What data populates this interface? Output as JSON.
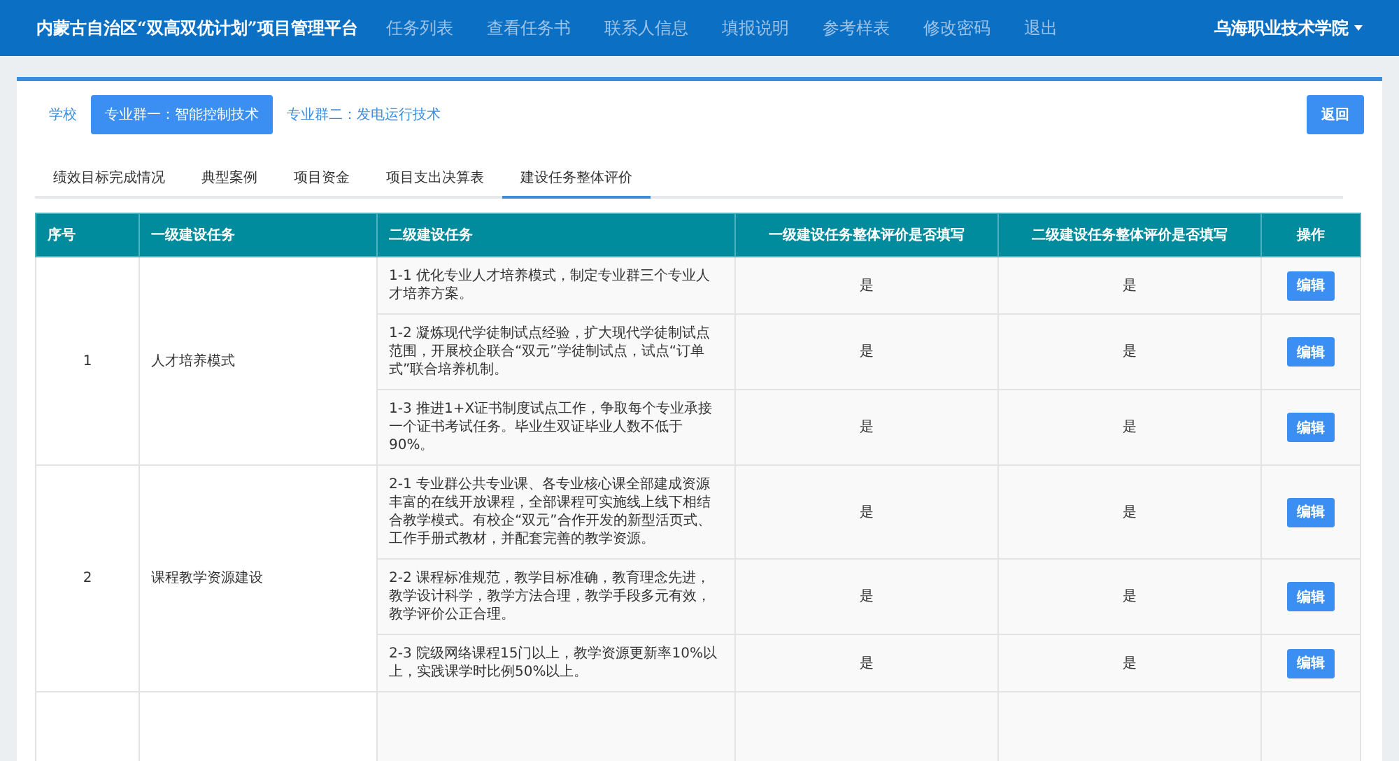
{
  "navbar": {
    "title": "内蒙古自治区“双高双优计划”项目管理平台",
    "links": [
      {
        "label": "任务列表"
      },
      {
        "label": "查看任务书"
      },
      {
        "label": "联系人信息"
      },
      {
        "label": "填报说明"
      },
      {
        "label": "参考样表"
      },
      {
        "label": "修改密码"
      },
      {
        "label": "退出"
      }
    ],
    "user": "乌海职业技术学院"
  },
  "group_tabs": [
    {
      "label": "学校",
      "selected": false
    },
    {
      "label": "专业群一：智能控制技术",
      "selected": true
    },
    {
      "label": "专业群二：发电运行技术",
      "selected": false
    }
  ],
  "back_button": "返回",
  "tabs": [
    {
      "label": "绩效目标完成情况",
      "selected": false
    },
    {
      "label": "典型案例",
      "selected": false
    },
    {
      "label": "项目资金",
      "selected": false
    },
    {
      "label": "项目支出决算表",
      "selected": false
    },
    {
      "label": "建设任务整体评价",
      "selected": true
    }
  ],
  "table": {
    "columns": [
      "序号",
      "一级建设任务",
      "二级建设任务",
      "一级建设任务整体评价是否填写",
      "二级建设任务整体评价是否填写",
      "操作"
    ],
    "groups": [
      {
        "index": "1",
        "name": "人才培养模式",
        "rows": [
          {
            "task": "1-1 优化专业人才培养模式，制定专业群三个专业人才培养方案。",
            "level1": "是",
            "level2": "是",
            "action": "编辑"
          },
          {
            "task": "1-2 凝炼现代学徒制试点经验，扩大现代学徒制试点范围，开展校企联合“双元”学徒制试点，试点“订单式”联合培养机制。",
            "level1": "是",
            "level2": "是",
            "action": "编辑"
          },
          {
            "task": "1-3 推进1+X证书制度试点工作，争取每个专业承接一个证书考试任务。毕业生双证毕业人数不低于90%。",
            "level1": "是",
            "level2": "是",
            "action": "编辑"
          }
        ]
      },
      {
        "index": "2",
        "name": "课程教学资源建设",
        "rows": [
          {
            "task": "2-1 专业群公共专业课、各专业核心课全部建成资源丰富的在线开放课程，全部课程可实施线上线下相结合教学模式。有校企“双元”合作开发的新型活页式、工作手册式教材，并配套完善的教学资源。",
            "level1": "是",
            "level2": "是",
            "action": "编辑"
          },
          {
            "task": "2-2 课程标准规范，教学目标准确，教育理念先进，教学设计科学，教学方法合理，教学手段多元有效，教学评价公正合理。",
            "level1": "是",
            "level2": "是",
            "action": "编辑"
          },
          {
            "task": "2-3 院级网络课程15门以上，教学资源更新率10%以上，实践课学时比例50%以上。",
            "level1": "是",
            "level2": "是",
            "action": "编辑"
          }
        ]
      }
    ]
  }
}
